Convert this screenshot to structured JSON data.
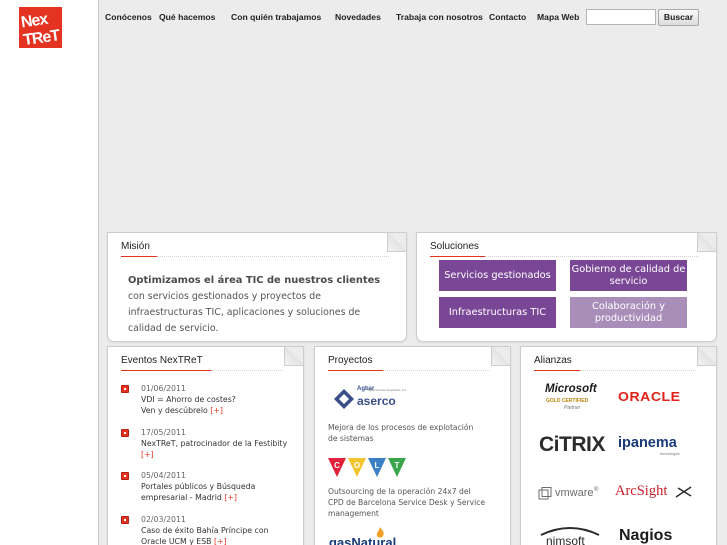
{
  "brand": {
    "logo_text": "NexTReT",
    "accent": "#e53321",
    "purple": "#7a4796"
  },
  "nav": {
    "items": [
      "Conócenos",
      "Qué hacemos",
      "Con quién trabajamos",
      "Novedades",
      "Trabaja con nosotros",
      "Contacto",
      "Mapa Web"
    ],
    "search_placeholder": "",
    "search_button": "Buscar"
  },
  "mision": {
    "title": "Misión",
    "lead": "Optimizamos el área TIC de nuestros clientes",
    "body": " con servicios gestionados y proyectos de infraestructuras TIC, aplicaciones y soluciones de calidad de servicio."
  },
  "soluciones": {
    "title": "Soluciones",
    "buttons": [
      "Servicios gestionados",
      "Gobierno de calidad de servicio",
      "Infraestructuras TIC",
      "Colaboración y productividad"
    ]
  },
  "eventos": {
    "title": "Eventos NexTReT",
    "items": [
      {
        "date": "01/06/2011",
        "text": "VDI = Ahorro de costes? Ven y descúbrelo",
        "more": "[+]"
      },
      {
        "date": "17/05/2011",
        "text": "NexTReT, patrocinador de la Festibity",
        "more": "[+]"
      },
      {
        "date": "05/04/2011",
        "text": "Portales públicos y Búsqueda empresarial - Madrid",
        "more": "[+]"
      },
      {
        "date": "02/03/2011",
        "text": "Caso de éxito Bahía Príncipe con Oracle UCM y ESB",
        "more": "[+]"
      }
    ]
  },
  "proyectos": {
    "title": "Proyectos",
    "items": [
      {
        "logo": "Agbar aserco",
        "logo_sub": "Agbar Servicios Compartidos, S.A.",
        "text": "Mejora de los procesos de explotación de sistemas"
      },
      {
        "logo": "COLT",
        "text": "Outsourcing de la operación 24x7 del CPD de Barcelona Service Desk y Service management"
      },
      {
        "logo": "gasNatural",
        "text": ""
      }
    ]
  },
  "alianzas": {
    "title": "Alianzas",
    "logos": {
      "microsoft": "Microsoft",
      "microsoft_sub": "GOLD CERTIFIED",
      "microsoft_partner": "Partner",
      "oracle": "ORACLE",
      "citrix": "CiTRIX",
      "ipanema": "ipanema",
      "ipanema_sub": "technologies",
      "vmware": "vmware",
      "arcsight": "ArcSight",
      "nimsoft": "nimsoft",
      "nagios": "Nagios"
    }
  }
}
